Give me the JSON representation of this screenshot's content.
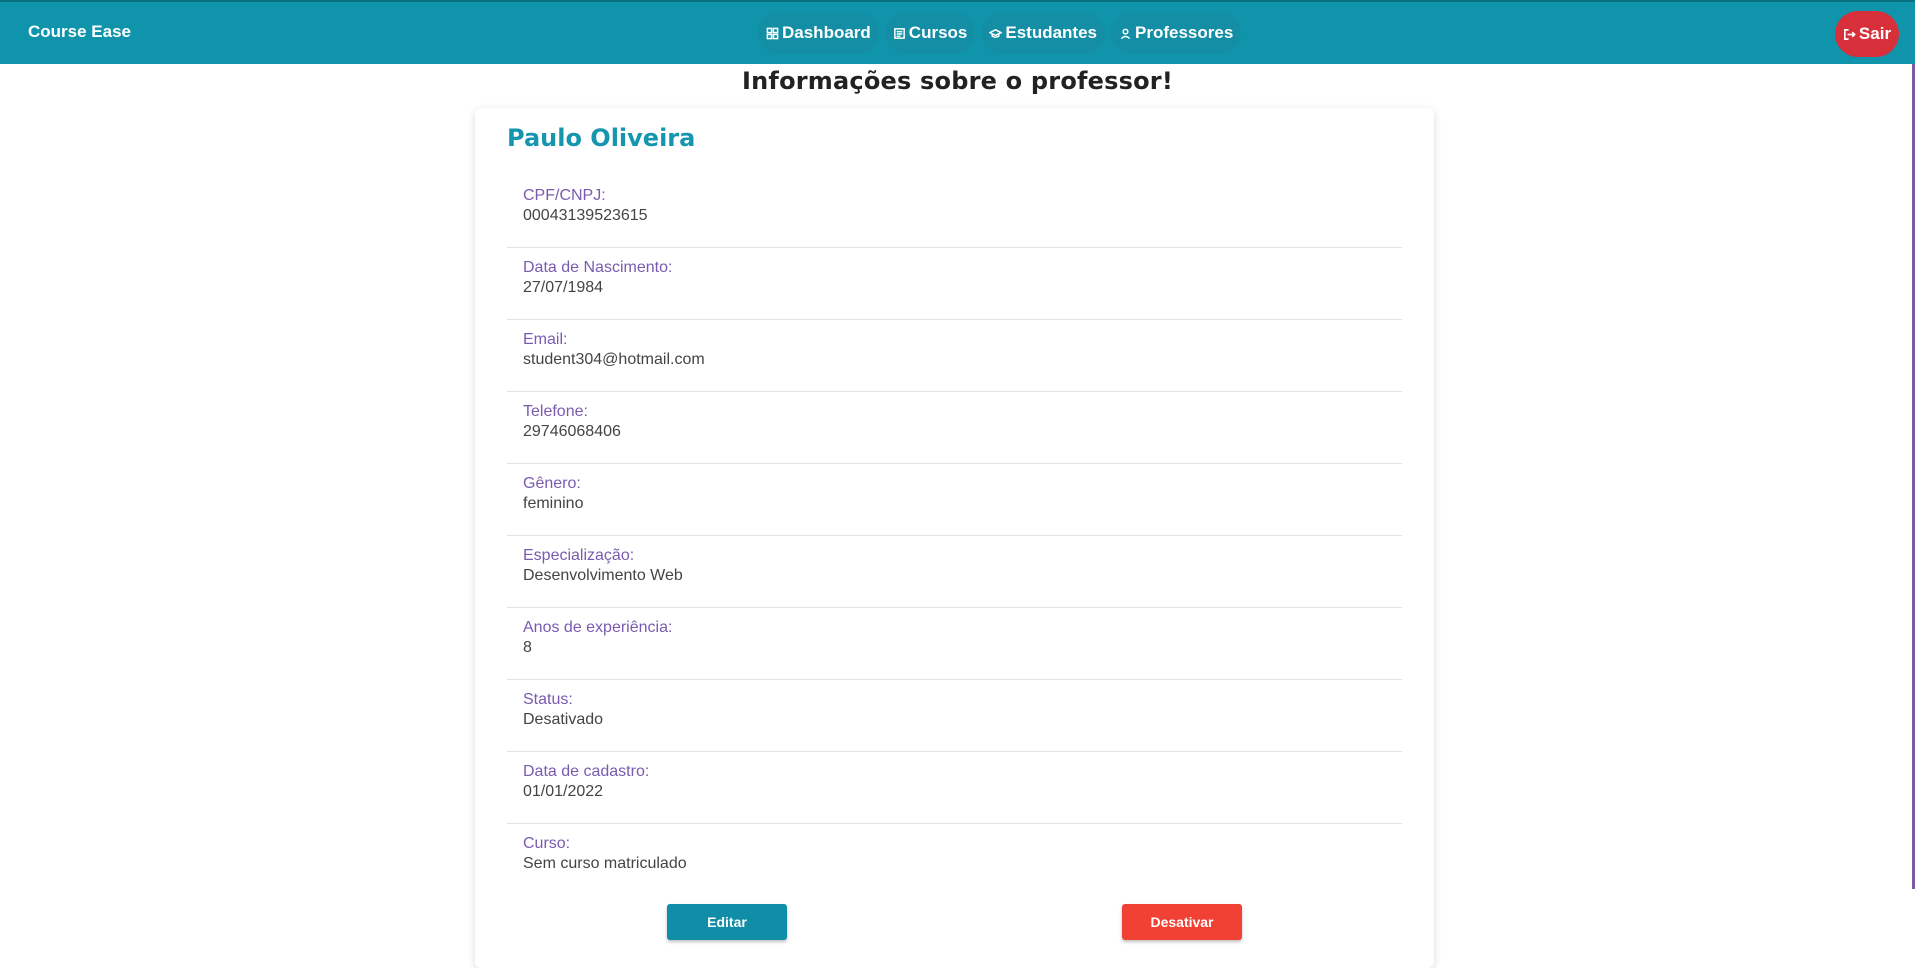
{
  "nav": {
    "brand": "Course Ease",
    "links": [
      {
        "label": "Dashboard",
        "icon": "dashboard-icon"
      },
      {
        "label": "Cursos",
        "icon": "book-icon"
      },
      {
        "label": "Estudantes",
        "icon": "graduation-cap-icon"
      },
      {
        "label": "Professores",
        "icon": "person-icon"
      }
    ],
    "logout": {
      "label": "Sair",
      "icon": "logout-icon"
    }
  },
  "page": {
    "title": "Informações sobre o professor!"
  },
  "professor": {
    "name": "Paulo Oliveira",
    "fields": [
      {
        "label": "CPF/CNPJ:",
        "value": "00043139523615"
      },
      {
        "label": "Data de Nascimento:",
        "value": "27/07/1984"
      },
      {
        "label": "Email:",
        "value": "student304@hotmail.com"
      },
      {
        "label": "Telefone:",
        "value": "29746068406"
      },
      {
        "label": "Gênero:",
        "value": "feminino"
      },
      {
        "label": "Especialização:",
        "value": "Desenvolvimento Web"
      },
      {
        "label": "Anos de experiência:",
        "value": "8"
      },
      {
        "label": "Status:",
        "value": "Desativado"
      },
      {
        "label": "Data de cadastro:",
        "value": "01/01/2022"
      },
      {
        "label": "Curso:",
        "value": "Sem curso matriculado"
      }
    ]
  },
  "actions": {
    "edit_label": "Editar",
    "disable_label": "Desativar"
  },
  "colors": {
    "primary": "#0f94ac",
    "label": "#7a5bb0",
    "danger": "#f04134",
    "logout": "#d7303a"
  }
}
